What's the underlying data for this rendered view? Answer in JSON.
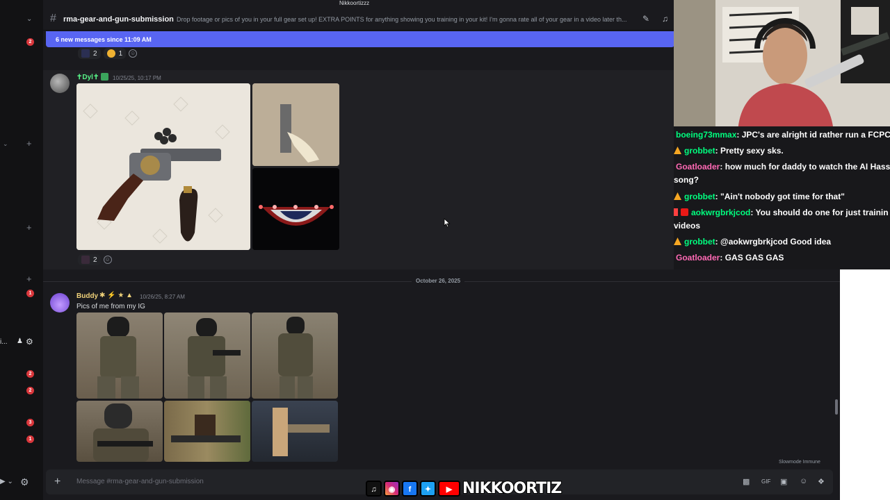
{
  "top_label": "Nikkoortizzz",
  "channel": {
    "name": "rma-gear-and-gun-submission",
    "topic": "Drop footage or pics of you in your full gear set up! EXTRA POINTS for anything showing you training in your kit! I'm gonna rate all of your gear in a video later th..."
  },
  "new_messages_banner": "6 new messages since 11:09 AM",
  "sidebar": {
    "badges": [
      "2",
      "1",
      "2",
      "2",
      "3",
      "1"
    ],
    "user_label": "i..."
  },
  "reactions_top": [
    {
      "count": "2"
    },
    {
      "count": "1"
    }
  ],
  "messages": [
    {
      "username": "✝Dyl✝",
      "timestamp": "10/25/25, 10:17 PM",
      "reactions": [
        {
          "count": "2"
        }
      ]
    },
    {
      "username": "Buddy",
      "timestamp": "10/26/25, 8:27 AM",
      "text": "Pics of me from my IG"
    }
  ],
  "date_divider": "October 26, 2025",
  "composer": {
    "placeholder": "Message #rma-gear-and-gun-submission",
    "slowmode": "Slowmode Immune"
  },
  "twitch_chat": [
    {
      "name": "boeing73mmax",
      "color": "#00ff7f",
      "text": ": JPC's are alright id rather run a FCPC"
    },
    {
      "name": "grobbet",
      "color": "#00ff7f",
      "text": ": Pretty sexy sks."
    },
    {
      "name": "Goatloader",
      "color": "#ff69b4",
      "text": ": how much for daddy to watch the AI Hass"
    },
    {
      "name": "",
      "color": "#ffffff",
      "text": "song?"
    },
    {
      "name": "grobbet",
      "color": "#00ff7f",
      "text": ": \"Ain't nobody got time for that\""
    },
    {
      "name": "aokwrgbrkjcod",
      "color": "#00ff7f",
      "text": ": You should do one for just trainin"
    },
    {
      "name": "",
      "color": "#ffffff",
      "text": "videos"
    },
    {
      "name": "grobbet",
      "color": "#00ff7f",
      "text": ": @aokwrgbrkjcod Good idea"
    },
    {
      "name": "Goatloader",
      "color": "#ff69b4",
      "text": ": GAS GAS GAS"
    }
  ],
  "social": {
    "handle": "NIKKOORTIZ",
    "icons": [
      "tiktok-icon",
      "instagram-icon",
      "facebook-icon",
      "twitter-icon",
      "youtube-icon"
    ]
  },
  "colors": {
    "accent": "#5865f2",
    "bg": "#1a1a1e",
    "badge": "#da373c"
  }
}
